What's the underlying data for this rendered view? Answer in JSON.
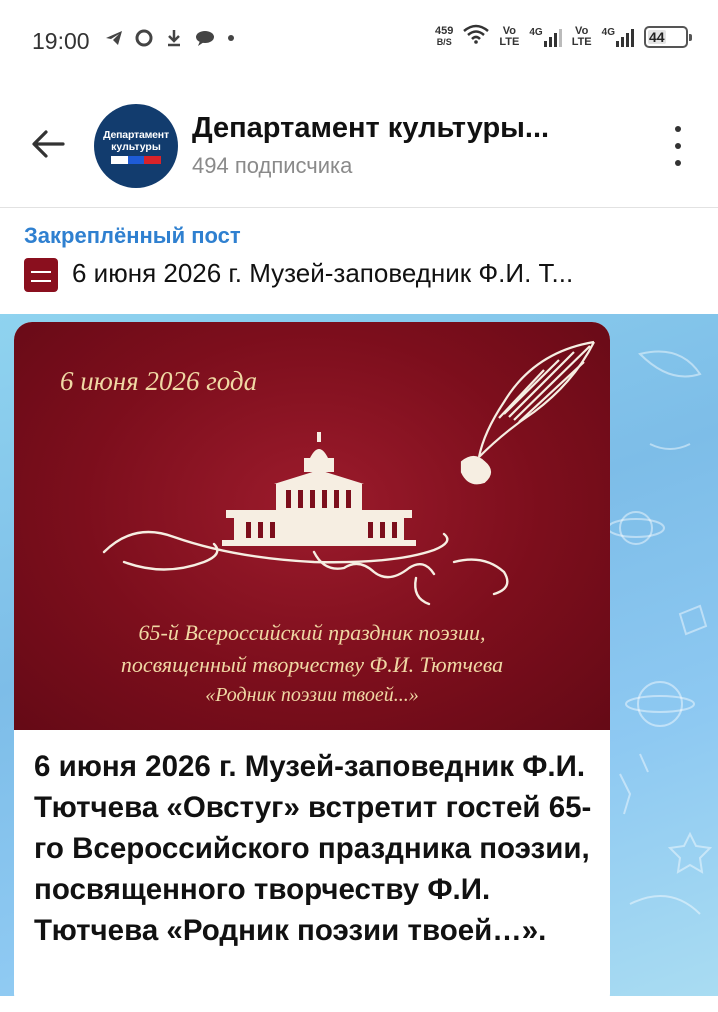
{
  "status_bar": {
    "time": "19:00",
    "net_speed_value": "459",
    "net_speed_unit": "B/S",
    "sim1_top": "Vo",
    "sim1_bottom": "LTE",
    "sim1_gen": "4G",
    "sim2_top": "Vo",
    "sim2_bottom": "LTE",
    "sim2_gen": "4G",
    "battery": "44",
    "battery_level": 0.44
  },
  "header": {
    "channel_title": "Департамент культуры...",
    "subscribers": "494 подписчика",
    "avatar_line1": "Департамент",
    "avatar_line2": "культуры"
  },
  "pinned": {
    "label": "Закреплённый пост",
    "text": "6 июня 2026 г. Музей-заповедник Ф.И. Т..."
  },
  "post": {
    "image_date": "6 июня 2026 года",
    "image_line1": "65-й Всероссийский праздник поэзии,",
    "image_line2": "посвященный творчеству Ф.И. Тютчева",
    "image_line3": "«Родник поэзии твоей...»",
    "text": "6 июня 2026 г. Музей-заповедник Ф.И. Тютчева «Овстуг» встретит гостей 65-го Всероссийского праздника поэзии, посвященного творчеству Ф.И. Тютчева «Родник поэзии твоей…»."
  },
  "colors": {
    "accent": "#2f80d0",
    "poster_bg": "#7c0e1c",
    "poster_text": "#f0d8a4",
    "avatar_bg": "#123c6e"
  }
}
